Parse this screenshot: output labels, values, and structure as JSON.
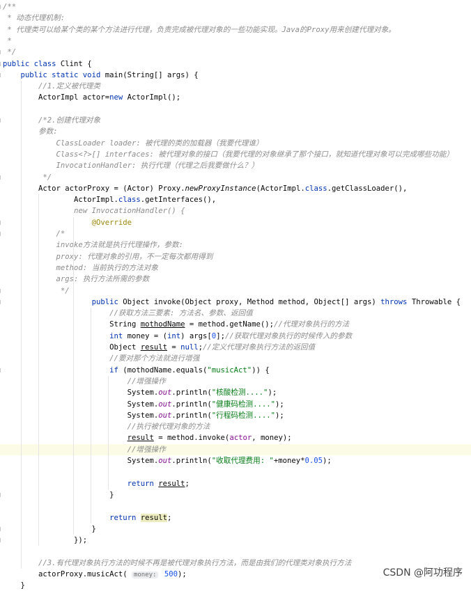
{
  "editor": {
    "lines": [
      [
        {
          "t": "/**",
          "c": "cm"
        }
      ],
      [
        {
          "t": " * 动态代理机制:",
          "c": "cm"
        }
      ],
      [
        {
          "t": " * 代理类可以给某个类的某个方法进行代理，负责完成被代理对象的一些功能实现。Java的Proxy用来创建代理对象。",
          "c": "cm"
        }
      ],
      [
        {
          "t": " *",
          "c": "cm"
        }
      ],
      [
        {
          "t": " */",
          "c": "cm"
        }
      ],
      [
        {
          "t": "public class ",
          "c": "kw"
        },
        {
          "t": "Clint {"
        }
      ],
      [
        {
          "t": "    "
        },
        {
          "t": "public static void ",
          "c": "kw"
        },
        {
          "t": "main(String[] args) {"
        }
      ],
      [
        {
          "t": "        "
        },
        {
          "t": "//1.定义被代理类",
          "c": "cm"
        }
      ],
      [
        {
          "t": "        ActorImpl actor="
        },
        {
          "t": "new ",
          "c": "kw"
        },
        {
          "t": "ActorImpl();"
        }
      ],
      [],
      [
        {
          "t": "        "
        },
        {
          "t": "/*2.创建代理对象",
          "c": "cm"
        }
      ],
      [
        {
          "t": "        "
        },
        {
          "t": "参数:",
          "c": "cm"
        }
      ],
      [
        {
          "t": "            "
        },
        {
          "t": "ClassLoader loader: 被代理的类的加载器（我要代理谁）",
          "c": "cm"
        }
      ],
      [
        {
          "t": "            "
        },
        {
          "t": "Class<?>[] interfaces: 被代理对象的接口（我要代理的对象继承了那个接口，就知道代理对象可以完成哪些功能）",
          "c": "cm"
        }
      ],
      [
        {
          "t": "            "
        },
        {
          "t": "InvocationHandler: 执行代理（代理之后我要做什么？）",
          "c": "cm"
        }
      ],
      [
        {
          "t": "         "
        },
        {
          "t": "*/",
          "c": "cm"
        }
      ],
      [
        {
          "t": "        Actor actorProxy = (Actor) Proxy."
        },
        {
          "t": "newProxyInstance",
          "c": "it"
        },
        {
          "t": "(ActorImpl."
        },
        {
          "t": "class",
          "c": "kw"
        },
        {
          "t": ".getClassLoader(),"
        }
      ],
      [
        {
          "t": "                ActorImpl."
        },
        {
          "t": "class",
          "c": "kw"
        },
        {
          "t": ".getInterfaces(),"
        }
      ],
      [
        {
          "t": "                "
        },
        {
          "t": "new InvocationHandler() {",
          "c": "cm"
        }
      ],
      [
        {
          "t": "                    "
        },
        {
          "t": "@Override",
          "c": "an"
        }
      ],
      [
        {
          "t": "            "
        },
        {
          "t": "/*",
          "c": "cm"
        }
      ],
      [
        {
          "t": "            "
        },
        {
          "t": "invoke方法就是执行代理操作，参数:",
          "c": "cm"
        }
      ],
      [
        {
          "t": "            "
        },
        {
          "t": "proxy: 代理对象的引用，不一定每次都用得到",
          "c": "cm"
        }
      ],
      [
        {
          "t": "            "
        },
        {
          "t": "method: 当前执行的方法对象",
          "c": "cm"
        }
      ],
      [
        {
          "t": "            "
        },
        {
          "t": "args: 执行方法所需的参数",
          "c": "cm"
        }
      ],
      [
        {
          "t": "             "
        },
        {
          "t": "*/",
          "c": "cm"
        }
      ],
      [
        {
          "t": "                    "
        },
        {
          "t": "public ",
          "c": "kw"
        },
        {
          "t": "Object invoke(Object proxy, Method method, Object[] args) "
        },
        {
          "t": "throws ",
          "c": "kw"
        },
        {
          "t": "Throwable {"
        }
      ],
      [
        {
          "t": "                        "
        },
        {
          "t": "//获取方法三要素: 方法名、参数、返回值",
          "c": "cm"
        }
      ],
      [
        {
          "t": "                        String "
        },
        {
          "t": "mothodName",
          "c": "ul"
        },
        {
          "t": " = method.getName();"
        },
        {
          "t": "//代理对象执行的方法",
          "c": "cm"
        }
      ],
      [
        {
          "t": "                        "
        },
        {
          "t": "int ",
          "c": "kw"
        },
        {
          "t": "money = ("
        },
        {
          "t": "int",
          "c": "kw"
        },
        {
          "t": ") args["
        },
        {
          "t": "0",
          "c": "num"
        },
        {
          "t": "];"
        },
        {
          "t": "//获取代理对象执行的时候传入的参数",
          "c": "cm"
        }
      ],
      [
        {
          "t": "                        Object "
        },
        {
          "t": "result",
          "c": "ul"
        },
        {
          "t": " = "
        },
        {
          "t": "null",
          "c": "kw"
        },
        {
          "t": ";"
        },
        {
          "t": "//定义代理对象执行方法的返回值",
          "c": "cm"
        }
      ],
      [
        {
          "t": "                        "
        },
        {
          "t": "//要对那个方法就进行增强",
          "c": "cm"
        }
      ],
      [
        {
          "t": "                        "
        },
        {
          "t": "if ",
          "c": "kw"
        },
        {
          "t": "(mothodName.equals("
        },
        {
          "t": "\"musicAct\"",
          "c": "str"
        },
        {
          "t": ")) {"
        }
      ],
      [
        {
          "t": "                            "
        },
        {
          "t": "//增强操作",
          "c": "cm"
        }
      ],
      [
        {
          "t": "                            System."
        },
        {
          "t": "out",
          "c": "sf"
        },
        {
          "t": ".println("
        },
        {
          "t": "\"核酸检测....\"",
          "c": "str"
        },
        {
          "t": ");"
        }
      ],
      [
        {
          "t": "                            System."
        },
        {
          "t": "out",
          "c": "sf"
        },
        {
          "t": ".println("
        },
        {
          "t": "\"健康码检测....\"",
          "c": "str"
        },
        {
          "t": ");"
        }
      ],
      [
        {
          "t": "                            System."
        },
        {
          "t": "out",
          "c": "sf"
        },
        {
          "t": ".println("
        },
        {
          "t": "\"行程码检测....\"",
          "c": "str"
        },
        {
          "t": ");"
        }
      ],
      [
        {
          "t": "                            "
        },
        {
          "t": "//执行被代理对象的方法",
          "c": "cm"
        }
      ],
      [
        {
          "t": "                            "
        },
        {
          "t": "result",
          "c": "ul"
        },
        {
          "t": " = method.invoke("
        },
        {
          "t": "actor",
          "c": "fld"
        },
        {
          "t": ", money);"
        }
      ],
      [
        {
          "t": "                            "
        },
        {
          "t": "//增强操作",
          "c": "cm"
        }
      ],
      [
        {
          "t": "                            System."
        },
        {
          "t": "out",
          "c": "sf"
        },
        {
          "t": ".println("
        },
        {
          "t": "\"收取代理费用: \"",
          "c": "str"
        },
        {
          "t": "+money*"
        },
        {
          "t": "0.05",
          "c": "num"
        },
        {
          "t": ");"
        }
      ],
      [],
      [
        {
          "t": "                            "
        },
        {
          "t": "return ",
          "c": "kw"
        },
        {
          "t": "result",
          "c": "ul"
        },
        {
          "t": ";"
        }
      ],
      [
        {
          "t": "                        }"
        }
      ],
      [],
      [
        {
          "t": "                        "
        },
        {
          "t": "return ",
          "c": "kw"
        },
        {
          "t": "result",
          "c": "hl"
        },
        {
          "t": ";"
        }
      ],
      [
        {
          "t": "                    }"
        }
      ],
      [
        {
          "t": "                });"
        }
      ],
      [],
      [
        {
          "t": "        "
        },
        {
          "t": "//3.有代理对象执行方法的时候不再是被代理对象执行方法，而是由我们的代理类对象执行方法",
          "c": "cm"
        }
      ],
      [
        {
          "t": "        actorProxy.musicAct( "
        },
        {
          "t": "money:",
          "c": "hint"
        },
        {
          "t": " "
        },
        {
          "t": "500",
          "c": "num"
        },
        {
          "t": ");"
        }
      ],
      [
        {
          "t": "    }"
        }
      ]
    ]
  },
  "watermark": "CSDN @阿功程序"
}
